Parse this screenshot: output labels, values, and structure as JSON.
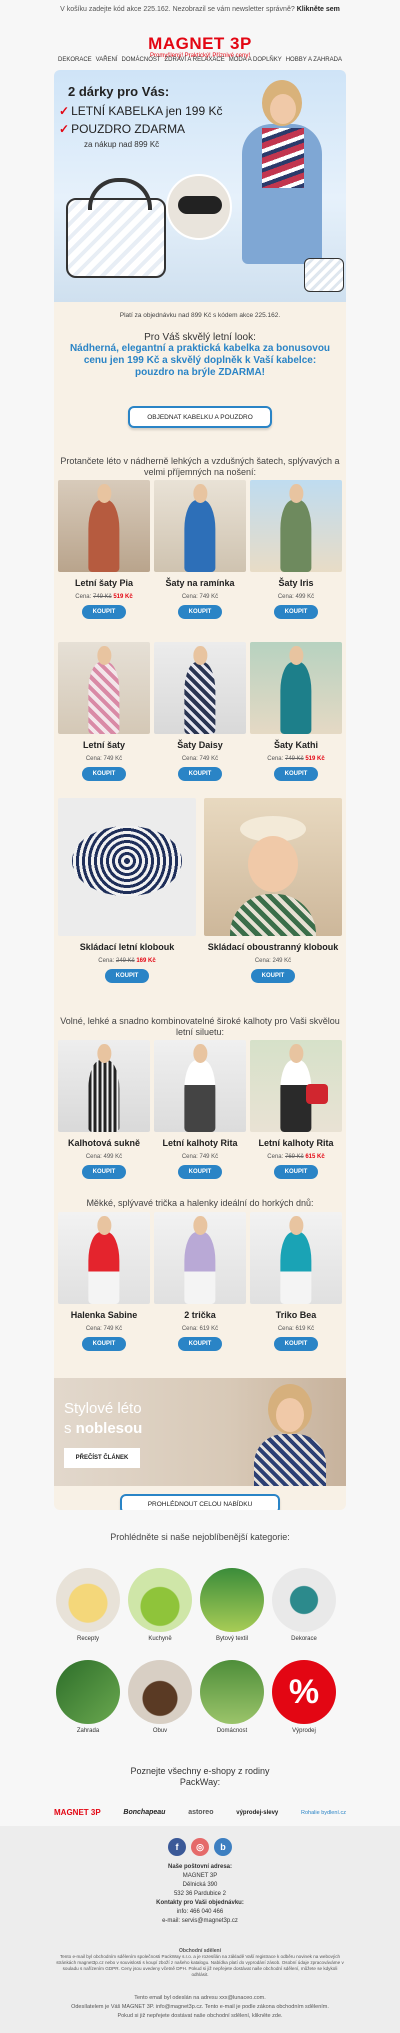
{
  "preheader": {
    "text": "V košíku zadejte kód akce 225.162. Nezobrazil se vám newsletter správně?",
    "link": "Klikněte sem"
  },
  "logo": {
    "name": "MAGNET 3P",
    "tagline": "Promyšlený! Praktický! Příznivé ceny!"
  },
  "nav": [
    "DEKORACE",
    "VAŘENÍ",
    "DOMÁCNOST",
    "ZDRAVÍ A RELAXACE",
    "MÓDA A DOPLŇKY",
    "HOBBY A ZAHRADA"
  ],
  "hero": {
    "title": "2 dárky pro Vás:",
    "line1": "LETNÍ KABELKA jen 199 Kč",
    "line2": "POUZDRO ZDARMA",
    "line3": "za nákup nad 899 Kč",
    "check": "✓"
  },
  "promo_note": "Platí za objednávku nad 899 Kč s kódem akce 225.162.",
  "intro": {
    "a": "Pro Váš skvělý letní look:",
    "b": "Nádherná, elegantní a praktická kabelka za bonusovou cenu jen 199 Kč a skvělý doplněk k Vaší kabelce: pouzdro na brýle ZDARMA!"
  },
  "order_button": "OBJEDNAT KABELKU A POUZDRO",
  "section_dresses": "Protančete léto v nádherně lehkých a vzdušných šatech, splývavých a velmi příjemných na nošení:",
  "section_pants": "Volné, lehké a snadno kombinovatelné široké kalhoty pro Vaši skvělou letní siluetu:",
  "section_tops": "Měkké, splývavé trička a halenky ideální do horkých dnů:",
  "price_label": "Cena:",
  "buy_label": "KOUPIT",
  "dresses": [
    {
      "name": "Letní šaty Pia",
      "old": "749 Kč",
      "price": "519 Kč"
    },
    {
      "name": "Šaty na ramínka",
      "price": "749 Kč"
    },
    {
      "name": "Šaty Iris",
      "price": "499 Kč"
    },
    {
      "name": "Letní šaty",
      "price": "749 Kč"
    },
    {
      "name": "Šaty Daisy",
      "price": "749 Kč"
    },
    {
      "name": "Šaty Kathi",
      "old": "749 Kč",
      "price": "519 Kč"
    }
  ],
  "hats": [
    {
      "name": "Skládací letní klobouk",
      "old": "249 Kč",
      "price": "169 Kč"
    },
    {
      "name": "Skládací oboustranný klobouk",
      "price": "249 Kč"
    }
  ],
  "pants": [
    {
      "name": "Kalhotová sukně",
      "price": "499 Kč"
    },
    {
      "name": "Letní kalhoty Rita",
      "price": "749 Kč"
    },
    {
      "name": "Letní kalhoty Rita",
      "old": "769 Kč",
      "price": "615 Kč"
    }
  ],
  "tops": [
    {
      "name": "Halenka Sabine",
      "price": "749 Kč"
    },
    {
      "name": "2 trička",
      "price": "619 Kč"
    },
    {
      "name": "Triko Bea",
      "price": "619 Kč"
    }
  ],
  "blog": {
    "line1": "Stylové léto",
    "line2a": "s ",
    "line2b": "noblesou",
    "button": "PŘEČÍST ČLÁNEK"
  },
  "all_offer_button": "PROHLÉDNOUT CELOU NABÍDKU",
  "categories_title": "Prohlédněte si naše nejoblíbenější kategorie:",
  "categories": [
    "Recepty",
    "Kuchyně",
    "Bytový textil",
    "Dekorace",
    "Zahrada",
    "Obuv",
    "Domácnost",
    "Výprodej"
  ],
  "eshops_title": "Poznejte všechny e-shopy z rodiny PackWay:",
  "brands": [
    "MAGNET 3P",
    "Bonchapeau",
    "astoreo",
    "výprodej-slevy",
    "Rohalie bydlení.cz"
  ],
  "footer": {
    "addr_title": "Naše poštovní adresa:",
    "addr1": "MAGNET 3P",
    "addr2": "Dělnická 390",
    "addr3": "532 36 Pardubice 2",
    "contact_title": "Kontakty pro Vaši objednávku:",
    "phone": "info: 466 040 466",
    "email": "e-mail: servis@magnet3p.cz",
    "legal_title": "Obchodní sdělení",
    "legal": "Tento e-mail byl obchodním sdělením společnosti PackWay s.r.o. a je rozesílán na základě Vaší registrace k odběru novinek na webových stránkách magnet3p.cz nebo v souvislosti s koupí zboží z našeho katalogu. Nabídka platí do vyprodání zásob. Osobní údaje zpracováváme v souladu s nařízením GDPR. Ceny jsou uvedeny včetně DPH. Pokud si již nepřejete dostávat naše obchodní sdělení, můžete se kdykoli odhlásit.",
    "unsub1": "Tento email byl odeslán na adresu xxx@lunaceo.com.",
    "unsub2": "Odesílatelem je Váš MAGNET 3P. info@magnet3p.cz. Tento e-mail je podle zákona obchodním sdělením.",
    "unsub3": "Pokud si již nepřejete dostávat naše obchodní sdělení, klikněte zde."
  },
  "colors": {
    "brand_red": "#e30613",
    "accent_blue": "#2a84c6",
    "card_bg": "#f8f1e6"
  }
}
